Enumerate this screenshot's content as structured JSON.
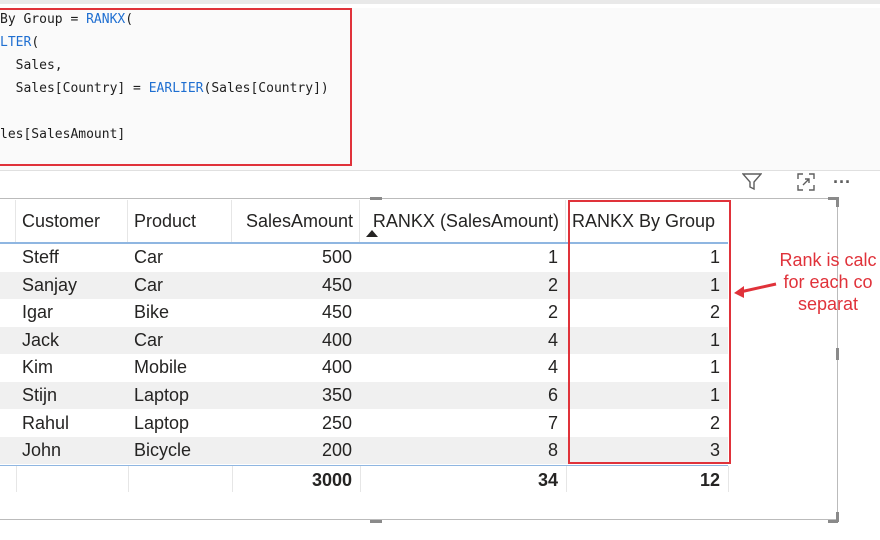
{
  "formula": {
    "lines": [
      {
        "a": "By Group = ",
        "b": "RANKX",
        "c": "("
      },
      {
        "a": "",
        "b": "LTER",
        "c": "("
      },
      {
        "a": "  Sales,",
        "b": "",
        "c": ""
      },
      {
        "a": "  Sales[Country] = ",
        "b": "EARLIER",
        "c": "(Sales[Country])"
      },
      {
        "a": "",
        "b": "",
        "c": ""
      },
      {
        "a": "les[SalesAmount]",
        "b": "",
        "c": ""
      }
    ]
  },
  "toolbar": {
    "filter_icon": "filter-icon",
    "focus_icon": "focus-mode-icon",
    "more_icon": "more-options-icon",
    "more_label": "···"
  },
  "table": {
    "headers": [
      "Customer",
      "Product",
      "SalesAmount",
      "RANKX (SalesAmount)",
      "RANKX By Group"
    ],
    "sorted_column": "RANKX (SalesAmount)",
    "rows": [
      {
        "customer": "Steff",
        "product": "Car",
        "sales": "500",
        "rank": "1",
        "group_rank": "1"
      },
      {
        "customer": "Sanjay",
        "product": "Car",
        "sales": "450",
        "rank": "2",
        "group_rank": "1"
      },
      {
        "customer": "Igar",
        "product": "Bike",
        "sales": "450",
        "rank": "2",
        "group_rank": "2"
      },
      {
        "customer": "Jack",
        "product": "Car",
        "sales": "400",
        "rank": "4",
        "group_rank": "1"
      },
      {
        "customer": "Kim",
        "product": "Mobile",
        "sales": "400",
        "rank": "4",
        "group_rank": "1"
      },
      {
        "customer": "Stijn",
        "product": "Laptop",
        "sales": "350",
        "rank": "6",
        "group_rank": "1"
      },
      {
        "customer": "Rahul",
        "product": "Laptop",
        "sales": "250",
        "rank": "7",
        "group_rank": "2"
      },
      {
        "customer": "John",
        "product": "Bicycle",
        "sales": "200",
        "rank": "8",
        "group_rank": "3"
      }
    ],
    "totals": {
      "sales": "3000",
      "rank": "34",
      "group_rank": "12"
    }
  },
  "annotation": {
    "lines": [
      "Rank is calc",
      "for each co",
      "separat"
    ]
  },
  "colors": {
    "highlight": "#e0323a",
    "keyword": "#1f6fd1",
    "header_line": "#8fb6e1"
  }
}
